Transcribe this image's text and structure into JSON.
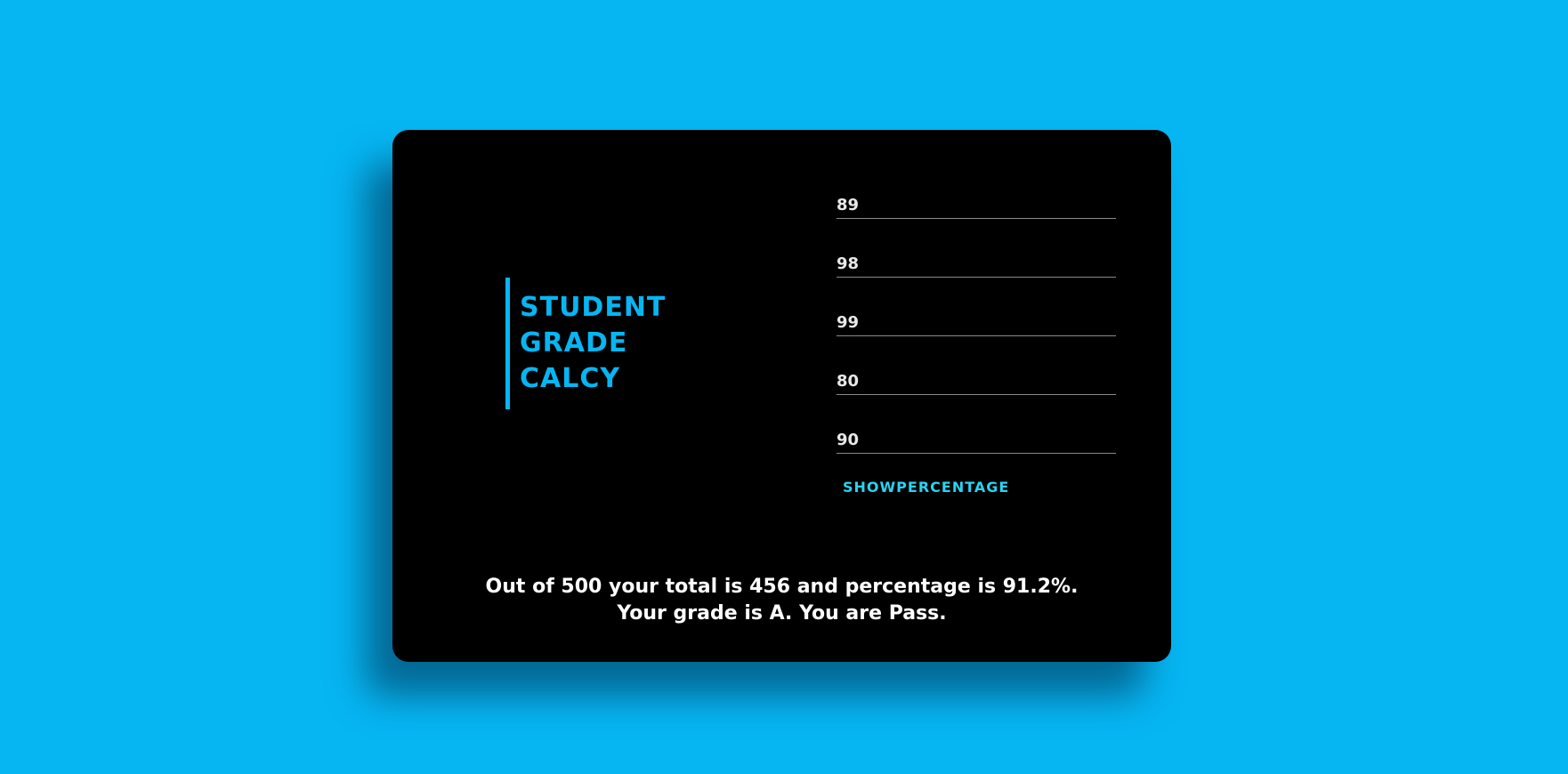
{
  "title": {
    "lines": [
      "STUDENT",
      "GRADE",
      "CALCY"
    ]
  },
  "inputs": [
    {
      "value": "89"
    },
    {
      "value": "98"
    },
    {
      "value": "99"
    },
    {
      "value": "80"
    },
    {
      "value": "90"
    }
  ],
  "button": {
    "label": "SHOWPERCENTAGE"
  },
  "result": {
    "line1": "Out of 500 your total is 456 and percentage is 91.2%.",
    "line2": "Your grade is A. You are Pass."
  },
  "colors": {
    "background": "#06b6f3",
    "card": "#000000",
    "accent": "#06b6f3",
    "button": "#29d3f2",
    "result_text": "#ffffff"
  }
}
